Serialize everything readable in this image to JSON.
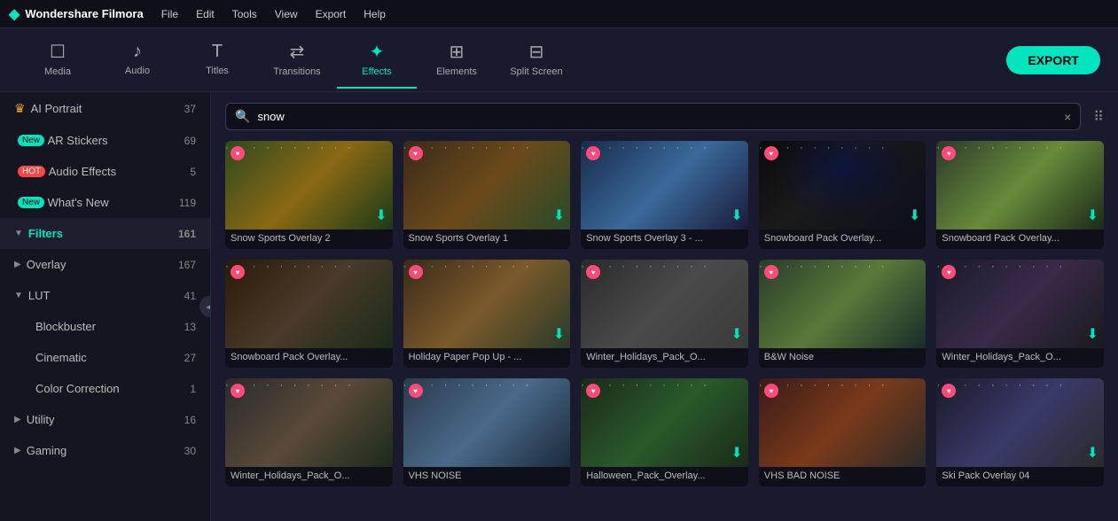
{
  "app": {
    "name": "Wondershare Filmora",
    "logo_icon": "◆"
  },
  "menu": {
    "items": [
      "File",
      "Edit",
      "Tools",
      "View",
      "Export",
      "Help"
    ]
  },
  "toolbar": {
    "items": [
      {
        "id": "media",
        "label": "Media",
        "icon": "☐"
      },
      {
        "id": "audio",
        "label": "Audio",
        "icon": "♪"
      },
      {
        "id": "titles",
        "label": "Titles",
        "icon": "T"
      },
      {
        "id": "transitions",
        "label": "Transitions",
        "icon": "⇄"
      },
      {
        "id": "effects",
        "label": "Effects",
        "icon": "✦"
      },
      {
        "id": "elements",
        "label": "Elements",
        "icon": "⊞"
      },
      {
        "id": "split-screen",
        "label": "Split Screen",
        "icon": "⊟"
      }
    ],
    "active": "effects",
    "export_label": "EXPORT"
  },
  "sidebar": {
    "items": [
      {
        "id": "ai-portrait",
        "label": "AI Portrait",
        "count": "37",
        "badge": null,
        "has_crown": true,
        "indent": 0,
        "expanded": false
      },
      {
        "id": "ar-stickers",
        "label": "AR Stickers",
        "count": "69",
        "badge": "new",
        "has_crown": false,
        "indent": 0,
        "expanded": false
      },
      {
        "id": "audio-effects",
        "label": "Audio Effects",
        "count": "5",
        "badge": "hot",
        "has_crown": false,
        "indent": 0,
        "expanded": false
      },
      {
        "id": "whats-new",
        "label": "What's New",
        "count": "119",
        "badge": "new",
        "has_crown": false,
        "indent": 0,
        "expanded": false
      },
      {
        "id": "filters",
        "label": "Filters",
        "count": "161",
        "badge": null,
        "has_crown": false,
        "indent": 0,
        "expanded": true,
        "active": true
      },
      {
        "id": "overlay",
        "label": "Overlay",
        "count": "167",
        "badge": null,
        "has_crown": false,
        "indent": 0,
        "expanded": false
      },
      {
        "id": "lut",
        "label": "LUT",
        "count": "41",
        "badge": null,
        "has_crown": false,
        "indent": 0,
        "expanded": true
      },
      {
        "id": "blockbuster",
        "label": "Blockbuster",
        "count": "13",
        "badge": null,
        "has_crown": false,
        "indent": 1
      },
      {
        "id": "cinematic",
        "label": "Cinematic",
        "count": "27",
        "badge": null,
        "has_crown": false,
        "indent": 1
      },
      {
        "id": "color-correction",
        "label": "Color Correction",
        "count": "1",
        "badge": null,
        "has_crown": false,
        "indent": 1
      },
      {
        "id": "utility",
        "label": "Utility",
        "count": "16",
        "badge": null,
        "has_crown": false,
        "indent": 0,
        "expanded": false
      },
      {
        "id": "gaming",
        "label": "Gaming",
        "count": "30",
        "badge": null,
        "has_crown": false,
        "indent": 0,
        "expanded": false
      }
    ]
  },
  "search": {
    "placeholder": "Search",
    "value": "snow",
    "clear_icon": "×"
  },
  "effects": {
    "items": [
      {
        "id": 1,
        "name": "Snow Sports Overlay 2",
        "thumb_class": "thumb-1",
        "has_fav": true,
        "has_download": true
      },
      {
        "id": 2,
        "name": "Snow Sports Overlay 1",
        "thumb_class": "thumb-2",
        "has_fav": true,
        "has_download": true
      },
      {
        "id": 3,
        "name": "Snow Sports Overlay 3 - ...",
        "thumb_class": "thumb-3",
        "has_fav": true,
        "has_download": true
      },
      {
        "id": 4,
        "name": "Snowboard Pack Overlay...",
        "thumb_class": "thumb-4",
        "has_fav": true,
        "has_download": true
      },
      {
        "id": 5,
        "name": "Snowboard Pack Overlay...",
        "thumb_class": "thumb-5",
        "has_fav": true,
        "has_download": true
      },
      {
        "id": 6,
        "name": "Snowboard Pack Overlay...",
        "thumb_class": "thumb-6",
        "has_fav": true,
        "has_download": false
      },
      {
        "id": 7,
        "name": "Holiday Paper Pop Up - ...",
        "thumb_class": "thumb-7",
        "has_fav": true,
        "has_download": true
      },
      {
        "id": 8,
        "name": "Winter_Holidays_Pack_O...",
        "thumb_class": "thumb-8",
        "has_fav": true,
        "has_download": true
      },
      {
        "id": 9,
        "name": "B&W Noise",
        "thumb_class": "thumb-9",
        "has_fav": true,
        "has_download": false
      },
      {
        "id": 10,
        "name": "Winter_Holidays_Pack_O...",
        "thumb_class": "thumb-10",
        "has_fav": true,
        "has_download": true
      },
      {
        "id": 11,
        "name": "Winter_Holidays_Pack_O...",
        "thumb_class": "thumb-11",
        "has_fav": true,
        "has_download": false
      },
      {
        "id": 12,
        "name": "VHS NOISE",
        "thumb_class": "thumb-12",
        "has_fav": true,
        "has_download": false
      },
      {
        "id": 13,
        "name": "Halloween_Pack_Overlay...",
        "thumb_class": "thumb-13",
        "has_fav": true,
        "has_download": true
      },
      {
        "id": 14,
        "name": "VHS BAD NOISE",
        "thumb_class": "thumb-14",
        "has_fav": true,
        "has_download": false
      },
      {
        "id": 15,
        "name": "Ski Pack Overlay 04",
        "thumb_class": "thumb-15",
        "has_fav": true,
        "has_download": true
      }
    ]
  }
}
